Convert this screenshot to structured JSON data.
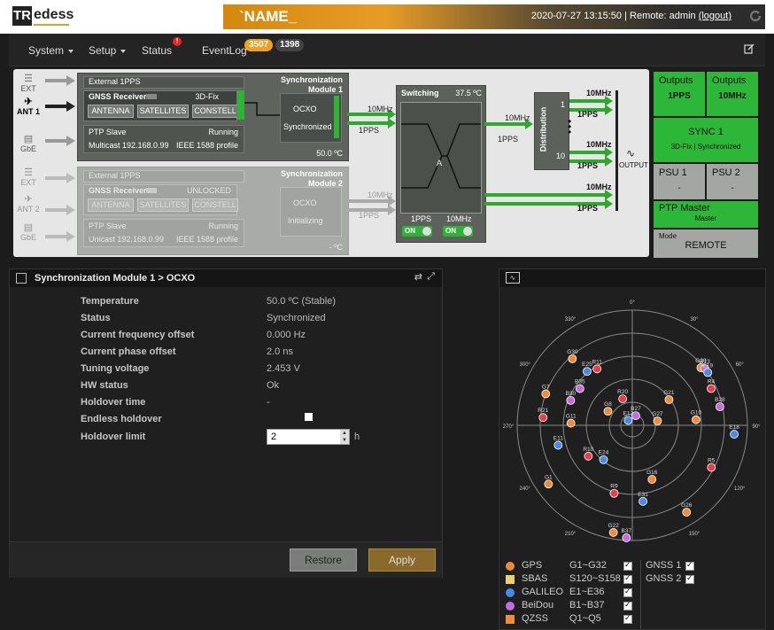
{
  "header": {
    "logo_text": "edess",
    "logo_letters": "TR",
    "device_name": "`NAME_",
    "datetime": "2020-07-27 13:15:50",
    "remote_label": "Remote:",
    "user": "admin",
    "logout": "(logout)"
  },
  "nav": {
    "system": "System",
    "setup": "Setup",
    "status": "Status",
    "eventlog": "EventLog",
    "badge1": "3507",
    "badge2": "1398"
  },
  "ports": {
    "ext": "EXT",
    "ant1": "ANT 1",
    "gbe": "GbE",
    "ant2": "ANT 2"
  },
  "module1": {
    "title": "Synchronization Module 1",
    "ext1pps": "External 1PPS",
    "gnss": "GNSS Receiver",
    "fix": "3D-Fix",
    "antenna": "ANTENNA",
    "satellites": "SATELLITES",
    "constell": "CONSTELL",
    "ptp": "PTP Slave",
    "ptp_state": "Running",
    "multicast": "Multicast 192.168.0.99",
    "ieee": "IEEE 1588 profile",
    "ocxo": "OCXO",
    "ocxo_state": "Synchronized",
    "temp": "50.0 ºC"
  },
  "module2": {
    "title": "Synchronization Module 2",
    "ext1pps": "External 1PPS",
    "gnss": "GNSS Receiver",
    "fix": "UNLOCKED",
    "antenna": "ANTENNA",
    "satellites": "SATELLITES",
    "constell": "CONSTELL",
    "ptp": "PTP Slave",
    "ptp_state": "Running",
    "unicast": "Unicast 192.168.0.99",
    "ieee": "IEEE 1588 profile",
    "ocxo": "OCXO",
    "ocxo_state": "Initializing",
    "temp": "- ºC"
  },
  "switching": {
    "title": "Switching",
    "temp": "37.5 ºC",
    "a": "A",
    "pps": "1PPS",
    "mhz": "10MHz",
    "on": "ON"
  },
  "signals": {
    "mhz10": "10MHz",
    "pps1": "1PPS",
    "distribution": "Distribution",
    "d1": "1",
    "d10": "10",
    "output": "OUTPUT"
  },
  "tiles": {
    "out1_t": "Outputs",
    "out1_v": "1PPS",
    "out2_t": "Outputs",
    "out2_v": "10MHz",
    "sync_t": "SYNC 1",
    "sync_v": "3D-Fix | Synchronized",
    "psu1_t": "PSU 1",
    "psu1_v": "-",
    "psu2_t": "PSU 2",
    "psu2_v": "-",
    "ptp_t": "PTP Master",
    "ptp_v": "Master",
    "mode_t": "Mode",
    "mode_v": "REMOTE"
  },
  "panel": {
    "title": "Synchronization Module 1 > OCXO",
    "rows": [
      {
        "label": "Temperature",
        "value": "50.0 ºC (Stable)"
      },
      {
        "label": "Status",
        "value": "Synchronized"
      },
      {
        "label": "Current frequency offset",
        "value": "0.000 Hz"
      },
      {
        "label": "Current phase offset",
        "value": "2.0 ns"
      },
      {
        "label": "Tuning voltage",
        "value": "2.453 V"
      },
      {
        "label": "HW status",
        "value": "Ok"
      },
      {
        "label": "Holdover time",
        "value": "-"
      },
      {
        "label": "Endless holdover",
        "value": ""
      },
      {
        "label": "Holdover limit",
        "value": ""
      }
    ],
    "holdover_limit": "2",
    "unit": "h",
    "restore": "Restore",
    "apply": "Apply"
  },
  "sky": {
    "angles": [
      "0°",
      "30°",
      "60°",
      "90°",
      "120°",
      "150°",
      "180°",
      "210°",
      "240°",
      "270°",
      "300°",
      "330°"
    ],
    "legend": [
      {
        "name": "GPS",
        "range": "G1~G32",
        "color": "#f08a3c",
        "shape": "circle"
      },
      {
        "name": "SBAS",
        "range": "S120~S158",
        "color": "#e8d36a",
        "shape": "square"
      },
      {
        "name": "GALILEO",
        "range": "E1~E36",
        "color": "#4a8be0",
        "shape": "circle"
      },
      {
        "name": "BeiDou",
        "range": "B1~B37",
        "color": "#c86ae0",
        "shape": "circle"
      },
      {
        "name": "QZSS",
        "range": "Q1~Q5",
        "color": "#f08a3c",
        "shape": "square"
      }
    ],
    "gnss1": "GNSS 1",
    "gnss2": "GNSS 2",
    "sats": [
      {
        "id": "G30",
        "c": "#f08a3c",
        "az": 318,
        "el": 20
      },
      {
        "id": "R11",
        "c": "#e8404a",
        "az": 328,
        "el": 38
      },
      {
        "id": "E25",
        "c": "#4a8be0",
        "az": 320,
        "el": 35
      },
      {
        "id": "B35",
        "c": "#c86ae0",
        "az": 305,
        "el": 40
      },
      {
        "id": "G7",
        "c": "#f08a3c",
        "az": 290,
        "el": 18
      },
      {
        "id": "B30",
        "c": "#c86ae0",
        "az": 292,
        "el": 38
      },
      {
        "id": "R21",
        "c": "#e8404a",
        "az": 275,
        "el": 20
      },
      {
        "id": "G11",
        "c": "#f08a3c",
        "az": 272,
        "el": 42
      },
      {
        "id": "E11",
        "c": "#4a8be0",
        "az": 255,
        "el": 30
      },
      {
        "id": "R10",
        "c": "#e8404a",
        "az": 235,
        "el": 48
      },
      {
        "id": "E24",
        "c": "#4a8be0",
        "az": 220,
        "el": 55
      },
      {
        "id": "G1",
        "c": "#f08a3c",
        "az": 235,
        "el": 10
      },
      {
        "id": "R9",
        "c": "#e8404a",
        "az": 195,
        "el": 35
      },
      {
        "id": "G22",
        "c": "#f08a3c",
        "az": 190,
        "el": 5
      },
      {
        "id": "B37",
        "c": "#c86ae0",
        "az": 183,
        "el": 2
      },
      {
        "id": "E31",
        "c": "#4a8be0",
        "az": 172,
        "el": 30
      },
      {
        "id": "G16",
        "c": "#f08a3c",
        "az": 160,
        "el": 45
      },
      {
        "id": "G26",
        "c": "#f08a3c",
        "az": 148,
        "el": 10
      },
      {
        "id": "R5",
        "c": "#e8404a",
        "az": 118,
        "el": 20
      },
      {
        "id": "E18",
        "c": "#4a8be0",
        "az": 95,
        "el": 10
      },
      {
        "id": "G8",
        "c": "#f08a3c",
        "az": 300,
        "el": 68
      },
      {
        "id": "R20",
        "c": "#e8404a",
        "az": 340,
        "el": 68
      },
      {
        "id": "E12",
        "c": "#4a8be0",
        "az": 320,
        "el": 85
      },
      {
        "id": "B27",
        "c": "#c86ae0",
        "az": 20,
        "el": 82
      },
      {
        "id": "G27",
        "c": "#f08a3c",
        "az": 80,
        "el": 70
      },
      {
        "id": "G21",
        "c": "#f08a3c",
        "az": 55,
        "el": 55
      },
      {
        "id": "G10",
        "c": "#f08a3c",
        "az": 85,
        "el": 40
      },
      {
        "id": "B28",
        "c": "#c86ae0",
        "az": 78,
        "el": 20
      },
      {
        "id": "R4",
        "c": "#e8404a",
        "az": 65,
        "el": 22
      },
      {
        "id": "G20",
        "c": "#f08a3c",
        "az": 50,
        "el": 20
      },
      {
        "id": "B13",
        "c": "#c86ae0",
        "az": 52,
        "el": 18
      },
      {
        "id": "E19",
        "c": "#4a8be0",
        "az": 55,
        "el": 18
      }
    ]
  }
}
